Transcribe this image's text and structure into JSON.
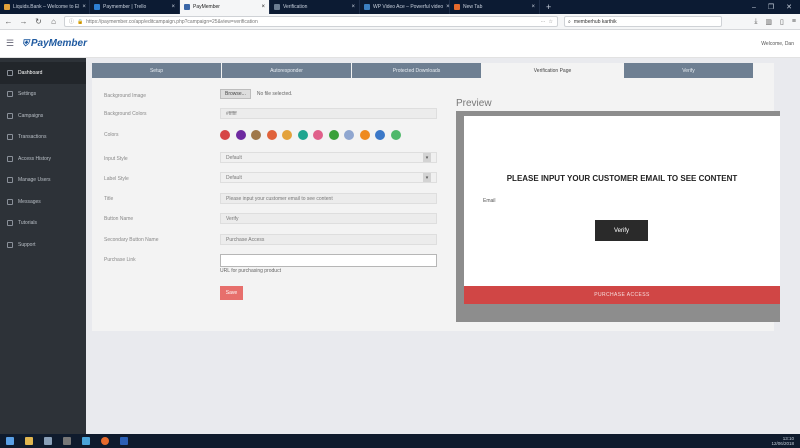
{
  "browser": {
    "tabs": [
      {
        "label": "Liquids.Bank – Welcome to El",
        "active": false,
        "color": "#e3a23b"
      },
      {
        "label": "Paymember | Trello",
        "active": false,
        "color": "#2d7fd3"
      },
      {
        "label": "PayMember",
        "active": true,
        "color": "#3a67a8"
      },
      {
        "label": "Verification",
        "active": false,
        "color": "#6b7c90"
      },
      {
        "label": "WP Video Ace – Powerful video",
        "active": false,
        "color": "#3b7fc1"
      },
      {
        "label": "New Tab",
        "active": false,
        "color": "#e66a2c"
      }
    ],
    "url": "https://paymember.co/app/editcampaign.php?campaign=25&view=verification",
    "search_value": "memberhub karthik"
  },
  "app": {
    "logo": "PayMember",
    "welcome": "Welcome, Dan"
  },
  "sidebar": {
    "items": [
      {
        "label": "Dashboard",
        "active": true
      },
      {
        "label": "Settings",
        "active": false
      },
      {
        "label": "Campaigns",
        "active": false
      },
      {
        "label": "Transactions",
        "active": false
      },
      {
        "label": "Access History",
        "active": false
      },
      {
        "label": "Manage Users",
        "active": false
      },
      {
        "label": "Messages",
        "active": false
      },
      {
        "label": "Tutorials",
        "active": false
      },
      {
        "label": "Support",
        "active": false
      }
    ]
  },
  "tabs": [
    {
      "label": "Setup",
      "active": false
    },
    {
      "label": "Autoresponder",
      "active": false
    },
    {
      "label": "Protected Downloads",
      "active": false
    },
    {
      "label": "Verification Page",
      "active": true
    },
    {
      "label": "Verify",
      "active": false
    }
  ],
  "form": {
    "background_image_label": "Background Image",
    "browse_label": "Browse...",
    "no_file_label": "No file selected.",
    "background_colors_label": "Background Colors",
    "background_colors_value": "#ffffff",
    "colors_label": "Colors",
    "swatches": [
      "#d64545",
      "#6e2aa0",
      "#a0784a",
      "#e0623a",
      "#e3a23b",
      "#1fa58f",
      "#e0608a",
      "#3aa03a",
      "#8fa6d0",
      "#ef8a1f",
      "#3b78c8",
      "#4fb86a"
    ],
    "input_style_label": "Input Style",
    "input_style_value": "Default",
    "label_style_label": "Label Style",
    "label_style_value": "Default",
    "title_label": "Title",
    "title_value": "Please input your customer email to see content",
    "button_name_label": "Button Name",
    "button_name_value": "Verify",
    "secondary_button_label": "Secondary Button Name",
    "secondary_button_value": "Purchase Access",
    "purchase_link_label": "Purchase Link",
    "purchase_link_value": "",
    "purchase_link_helper": "URL for purchasing product",
    "save_label": "Save"
  },
  "preview": {
    "title": "Preview",
    "heading": "PLEASE INPUT YOUR CUSTOMER EMAIL TO SEE CONTENT",
    "email_label": "Email",
    "verify_label": "Verify",
    "purchase_label": "PURCHASE ACCESS"
  },
  "taskbar": {
    "time": "13:10",
    "date": "12/06/2018"
  }
}
